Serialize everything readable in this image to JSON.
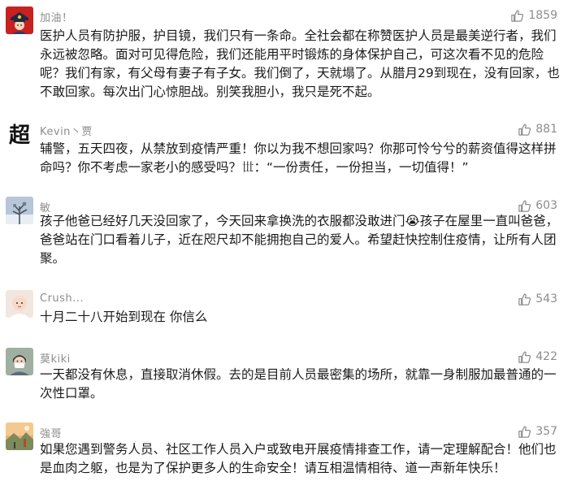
{
  "comments": [
    {
      "username": "加油！",
      "avatar_icon": "police-avatar-icon",
      "like_icon": "thumbs-up-icon",
      "likes": "1859",
      "text": "医护人员有防护服，护目镜，我们只有一条命。全社会都在称赞医护人员是最美逆行者，我们永远被忽略。面对可见得危险，我们还能用平时锻炼的身体保护自己，可这次看不见的危险呢？我们有家，有父母有妻子有子女。我们倒了，天就塌了。从腊月29到现在，没有回家，也不敢回家。每次出门心惊胆战。别笑我胆小，我只是死不起。"
    },
    {
      "username": "Kevin丶贾",
      "avatar_icon": "calligraphy-avatar-icon",
      "avatar_char": "超",
      "like_icon": "thumbs-up-icon",
      "likes": "881",
      "text": "辅警，五天四夜，从禁放到疫情严重！你以为我不想回家吗？你那可怜兮兮的薪资值得这样拼命吗？你不考虑一家老小的感受吗？𠀍：“一份责任，一份担当，一切值得！”"
    },
    {
      "username": "敏",
      "avatar_icon": "winter-tree-avatar-icon",
      "like_icon": "thumbs-up-icon",
      "likes": "603",
      "text": "孩子他爸已经好几天没回家了，今天回来拿换洗的衣服都没敢进门😭孩子在屋里一直叫爸爸，爸爸站在门口看着儿子，近在咫尺却不能拥抱自己的爱人。希望赶快控制住疫情，让所有人团聚。"
    },
    {
      "username": "Crush...",
      "avatar_icon": "baby-avatar-icon",
      "like_icon": "thumbs-up-icon",
      "likes": "543",
      "text": "十月二十八开始到现在  你信么"
    },
    {
      "username": "莫kiki",
      "avatar_icon": "masked-person-avatar-icon",
      "like_icon": "thumbs-up-icon",
      "likes": "422",
      "text": "一天都没有休息，直接取消休假。去的是目前人员最密集的场所，就靠一身制服加最普通的一次性口罩。"
    },
    {
      "username": "強哥",
      "avatar_icon": "landscape-avatar-icon",
      "like_icon": "thumbs-up-icon",
      "likes": "357",
      "text": "如果您遇到警务人员、社区工作人员入户或致电开展疫情排查工作，请一定理解配合！他们也是血肉之躯，也是为了保护更多人的生命安全！请互相温情相待、道一声新年快乐！"
    }
  ]
}
